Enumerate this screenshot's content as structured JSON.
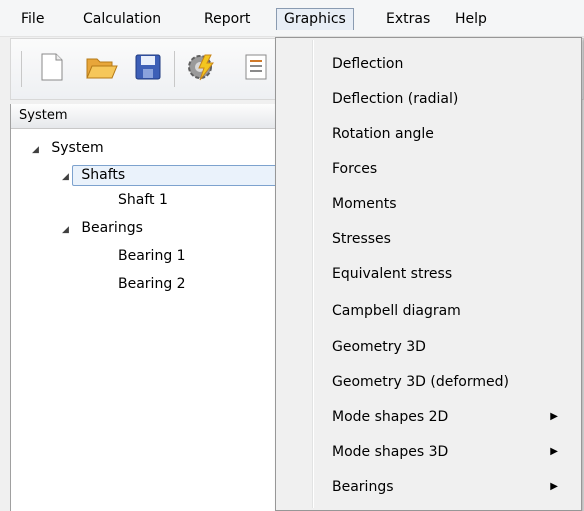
{
  "menubar": {
    "items": [
      "File",
      "Calculation",
      "Report",
      "Graphics",
      "Extras",
      "Help"
    ],
    "open_index": 3
  },
  "toolbar": {
    "buttons": [
      "new-file-icon",
      "open-folder-icon",
      "save-icon",
      "calculate-icon",
      "report-icon"
    ]
  },
  "panel": {
    "header": "System",
    "tree": [
      {
        "label": "System",
        "level": 0,
        "expanded": true
      },
      {
        "label": "Shafts",
        "level": 1,
        "expanded": true,
        "selected": true
      },
      {
        "label": "Shaft 1",
        "level": 2
      },
      {
        "label": "Bearings",
        "level": 1,
        "expanded": true
      },
      {
        "label": "Bearing 1",
        "level": 2
      },
      {
        "label": "Bearing 2",
        "level": 2
      }
    ]
  },
  "dropdown": {
    "items": [
      {
        "label": "Deflection",
        "submenu": false
      },
      {
        "label": "Deflection (radial)",
        "submenu": false
      },
      {
        "label": "Rotation angle",
        "submenu": false
      },
      {
        "label": "Forces",
        "submenu": false
      },
      {
        "label": "Moments",
        "submenu": false
      },
      {
        "label": "Stresses",
        "submenu": false
      },
      {
        "label": "Equivalent stress",
        "submenu": false
      },
      {
        "label": "Campbell diagram",
        "submenu": false
      },
      {
        "label": "Geometry 3D",
        "submenu": false
      },
      {
        "label": "Geometry 3D (deformed)",
        "submenu": false
      },
      {
        "label": "Mode shapes 2D",
        "submenu": true
      },
      {
        "label": "Mode shapes 3D",
        "submenu": true
      },
      {
        "label": "Bearings",
        "submenu": true
      }
    ]
  },
  "colors": {
    "selection_border": "#7da2ce",
    "selection_fill": "#eaf2fb",
    "menu_open_bg": "#e8eef6"
  }
}
